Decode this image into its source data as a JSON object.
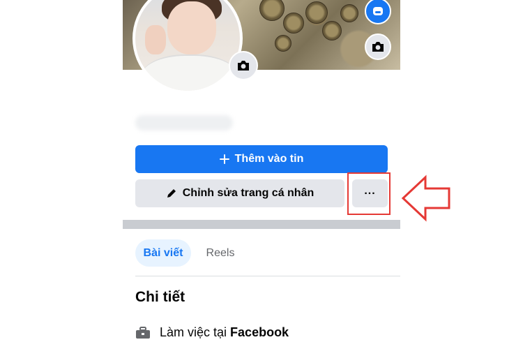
{
  "profile": {
    "actions": {
      "add_story_label": "Thêm vào tin",
      "edit_profile_label": "Chỉnh sửa trang cá nhân",
      "more_label": "..."
    },
    "tabs": [
      {
        "label": "Bài viết",
        "active": true
      },
      {
        "label": "Reels",
        "active": false
      }
    ],
    "details": {
      "title": "Chi tiết",
      "work_prefix": "Làm việc tại",
      "work_place": "Facebook"
    }
  },
  "icons": {
    "add_story": "plus-icon",
    "edit_profile": "pencil-icon",
    "avatar_camera": "camera-icon",
    "cover_camera": "camera-icon",
    "cover_badge": "messenger-avatar-icon",
    "work": "briefcase-icon"
  },
  "colors": {
    "primary": "#1877f2",
    "secondary_button": "#e4e6eb",
    "active_tab_bg": "#e7f3ff",
    "annotation": "#e53935"
  }
}
